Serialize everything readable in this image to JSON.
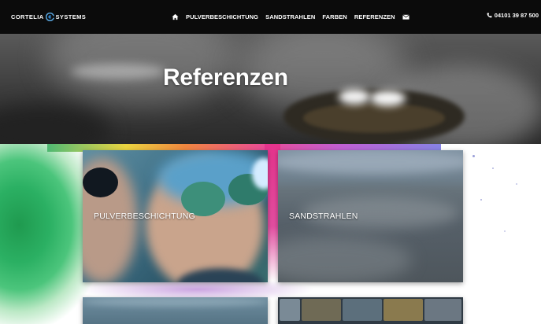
{
  "brand": {
    "left": "CORTELIA",
    "right": "SYSTEMS"
  },
  "nav": {
    "items": [
      {
        "label": "PULVERBESCHICHTUNG"
      },
      {
        "label": "SANDSTRAHLEN"
      },
      {
        "label": "FARBEN"
      },
      {
        "label": "REFERENZEN"
      }
    ],
    "phone": "04101 39 87 500"
  },
  "hero": {
    "title": "Referenzen"
  },
  "cards": [
    {
      "label": "PULVERBESCHICHTUNG"
    },
    {
      "label": "SANDSTRAHLEN"
    }
  ],
  "colors": {
    "navbar": "#0b0b0b",
    "splash_green": "#2bb063",
    "splash_pink": "#e5338c"
  },
  "icons": [
    "home-icon",
    "envelope-icon",
    "phone-icon",
    "logo-c-icon"
  ]
}
